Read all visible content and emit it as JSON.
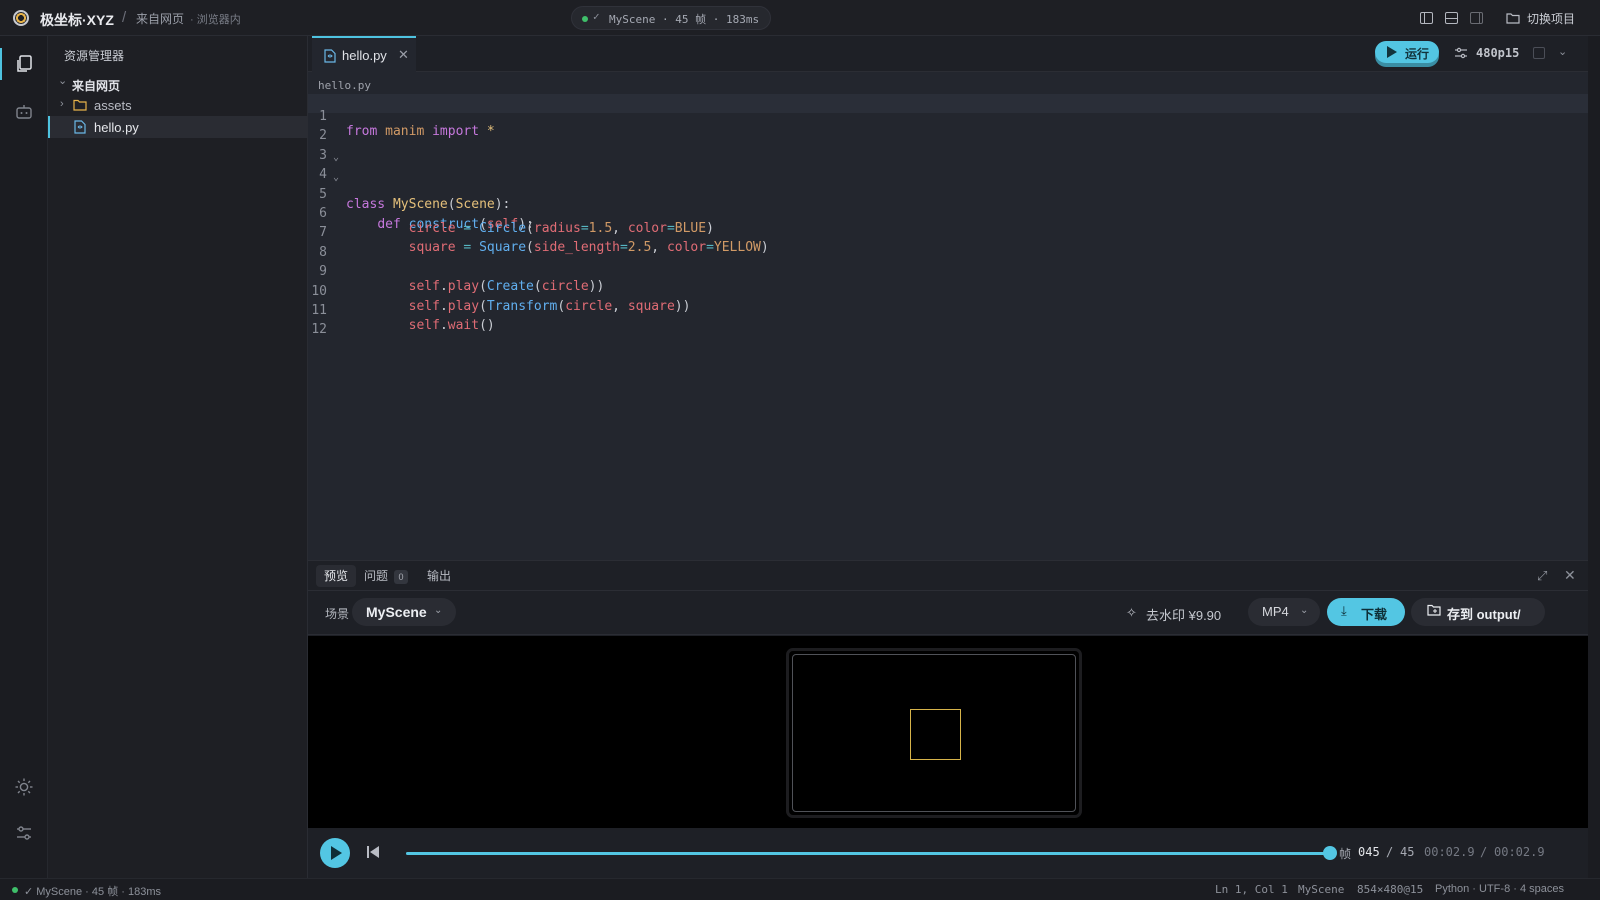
{
  "app": {
    "title": "极坐标·XYZ",
    "breadcrumb_sep": "/",
    "source": "来自网页",
    "location": "· 浏览器内",
    "switch_project": "切换项目"
  },
  "status_pill": {
    "check": "✓",
    "text": "MyScene · 45 帧 · 183ms"
  },
  "sidebar": {
    "title": "资源管理器",
    "root": {
      "chevron": "⌄",
      "label": "来自网页"
    },
    "items": [
      {
        "chevron": "›",
        "label": "assets",
        "icon": "folder-icon"
      },
      {
        "label": "hello.py",
        "icon": "python-file-icon",
        "selected": true
      }
    ]
  },
  "editor": {
    "tab": {
      "label": "hello.py",
      "close": "✕"
    },
    "run_label": "运行",
    "quality": "480p15",
    "chevron": "⌄",
    "breadcrumb": "hello.py",
    "cursor_line": 1,
    "fold_marker": "⌄",
    "lines": [
      {
        "n": "1"
      },
      {
        "n": "2"
      },
      {
        "n": "3"
      },
      {
        "n": "4"
      },
      {
        "n": "5"
      },
      {
        "n": "6"
      },
      {
        "n": "7"
      },
      {
        "n": "8"
      },
      {
        "n": "9"
      },
      {
        "n": "10"
      },
      {
        "n": "11"
      },
      {
        "n": "12"
      }
    ],
    "code": {
      "l1": {
        "from": "from",
        "mod": "manim",
        "imp": "import",
        "star": "*"
      },
      "l4": {
        "kw": "class",
        "name": "MyScene",
        "base": "Scene"
      },
      "l5": {
        "kw": "def",
        "name": "construct",
        "self": "self"
      },
      "l6": {
        "var": "circle",
        "cls": "Circle",
        "arg1": "radius",
        "v1": "1.5",
        "arg2": "color",
        "v2": "BLUE"
      },
      "l7": {
        "var": "square",
        "cls": "Square",
        "arg1": "side_length",
        "v1": "2.5",
        "arg2": "color",
        "v2": "YELLOW"
      },
      "l9": {
        "self": "self",
        "m": "play",
        "fn": "Create",
        "a": "circle"
      },
      "l10": {
        "self": "self",
        "m": "play",
        "fn": "Transform",
        "a": "circle",
        "b": "square"
      },
      "l11": {
        "self": "self",
        "m": "wait"
      }
    }
  },
  "panel": {
    "tabs": {
      "preview": "预览",
      "problems": "问题",
      "problems_count": "0",
      "output": "输出"
    },
    "expand": "⤢",
    "close": "✕",
    "scene_label": "场景",
    "scene_value": "MyScene",
    "chevron": "⌄",
    "watermark_icon": "✧",
    "watermark": "去水印 ¥9.90",
    "format": "MP4",
    "download": "下载",
    "download_icon": "⤓",
    "save": "存到 output/"
  },
  "transport": {
    "progress": 1.0,
    "frame_label": "帧",
    "frame_current": "045",
    "frame_sep": "/",
    "frame_total": "45",
    "time_current": "00:02.9",
    "time_sep": "/",
    "time_total": "00:02.9"
  },
  "statusbar": {
    "left": "✓ MyScene · 45 帧 · 183ms",
    "position": "Ln 1, Col 1",
    "scene": "MyScene",
    "resolution": "854×480@15",
    "lang": "Python · UTF-8 · 4 spaces"
  },
  "colors": {
    "accent": "#53c6e3",
    "ok": "#3fbf6a",
    "square": "#d6b34a"
  }
}
